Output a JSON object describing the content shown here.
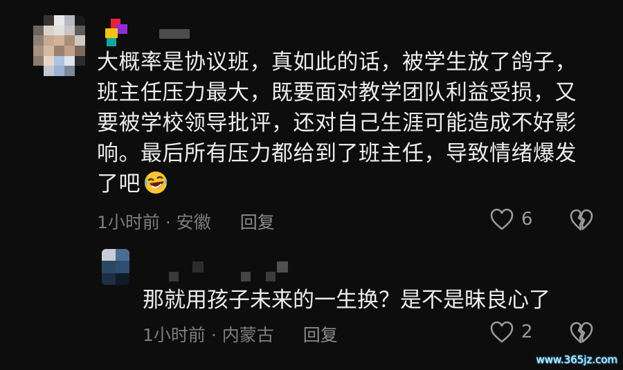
{
  "comment": {
    "text": "大概率是协议班，真如此的话，被学生放了鸽子，班主任压力最大，既要面对教学团队利益受损，又要被学校领导批评，还对自己生涯可能造成不好影响。最后所有压力都给到了班主任，导致情绪爆发了吧",
    "emoji_icon": "rolling-laughing-face-icon",
    "time": "1小时前",
    "separator": "·",
    "location": "安徽",
    "reply_label": "回复",
    "like_count": "6"
  },
  "reply": {
    "text": "那就用孩子未来的一生换？是不是昧良心了",
    "time": "1小时前",
    "separator": "·",
    "location": "内蒙古",
    "reply_label": "回复",
    "like_count": "2"
  },
  "watermark": "www.365jz.com",
  "colors": {
    "background": "#0d0d0d",
    "text": "#ececec",
    "meta": "#7d7d7d",
    "icon": "#9a9a9a"
  }
}
